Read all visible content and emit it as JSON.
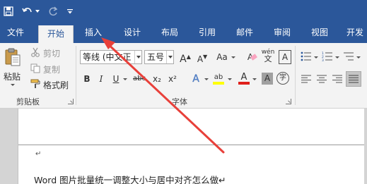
{
  "quick_access": {
    "save_icon": "save-icon",
    "undo_icon": "undo-icon",
    "redo_icon": "redo-icon",
    "customize_icon": "customize-qat-icon"
  },
  "tabs": [
    {
      "label": "文件"
    },
    {
      "label": "开始"
    },
    {
      "label": "插入"
    },
    {
      "label": "设计"
    },
    {
      "label": "布局"
    },
    {
      "label": "引用"
    },
    {
      "label": "邮件"
    },
    {
      "label": "审阅"
    },
    {
      "label": "视图"
    },
    {
      "label": "开发"
    }
  ],
  "clipboard": {
    "paste_label": "粘贴",
    "cut_label": "剪切",
    "copy_label": "复制",
    "format_painter_label": "格式刷",
    "group_label": "剪贴板"
  },
  "font": {
    "font_name": "等线 (中文正",
    "font_size": "五号",
    "grow_label": "A",
    "shrink_label": "A",
    "case_label": "Aa",
    "clear_label": "A",
    "phonetic_label": "wén",
    "border_char_label": "A",
    "bold_label": "B",
    "italic_label": "I",
    "underline_label": "U",
    "strike_label": "abc",
    "subscript_label": "x₂",
    "superscript_label": "x²",
    "effects_label": "A",
    "highlight_label": "ab",
    "color_label": "A",
    "shading_label": "A",
    "enclose_label": "字",
    "group_label": "字体"
  },
  "document": {
    "paragraph_mark": "↵",
    "line1": "Word 图片批量统一调整大小与居中对齐怎么做↵"
  },
  "colors": {
    "titlebar": "#2b579a",
    "ribbon": "#f3f3f3",
    "annotation_arrow": "#e8403a",
    "highlight_yellow": "#ffff00",
    "font_color_red": "#e0201b"
  }
}
